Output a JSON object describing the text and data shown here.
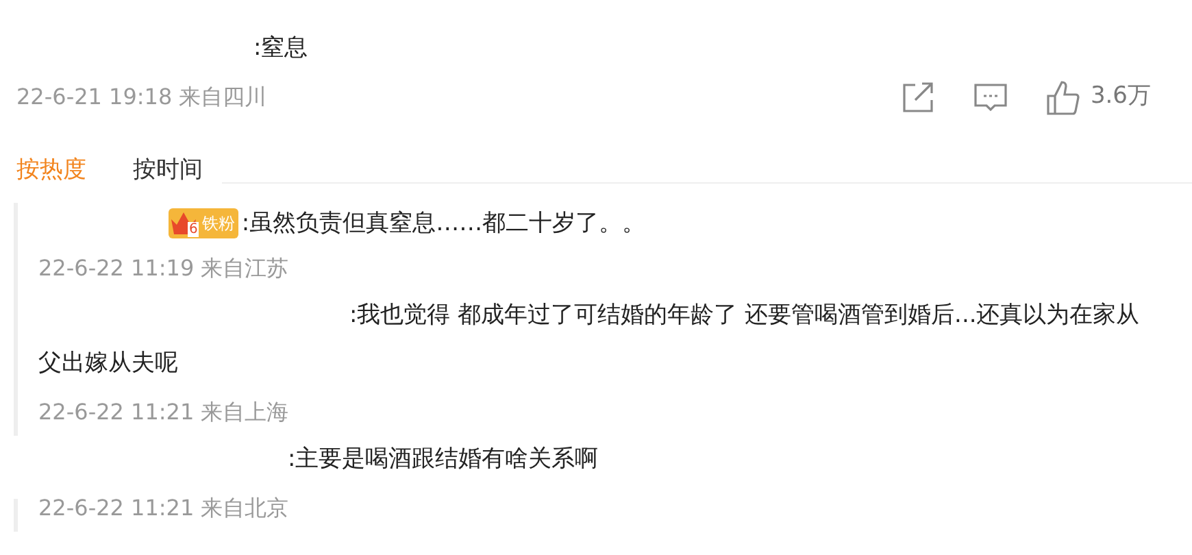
{
  "comment": {
    "text": ":窒息",
    "meta": "22-6-21 19:18 来自四川",
    "likes": "3.6万"
  },
  "sort_tabs": [
    {
      "label": "按热度",
      "selected": true
    },
    {
      "label": "按时间",
      "selected": false
    }
  ],
  "replies": [
    {
      "badge": {
        "level": "6",
        "label": "铁粉"
      },
      "text": ":虽然负责但真窒息……都二十岁了。。",
      "meta": "22-6-22 11:19 来自江苏",
      "thread_bar": true
    },
    {
      "text": ":我也觉得 都成年过了可结婚的年龄了 还要管喝酒管到婚后...还真以为在家从父出嫁从夫呢",
      "meta": "22-6-22 11:21 来自上海",
      "thread_bar": true
    },
    {
      "text": ":主要是喝酒跟结婚有啥关系啊",
      "meta": "22-6-22 11:21 来自北京",
      "thread_bar": true
    }
  ]
}
